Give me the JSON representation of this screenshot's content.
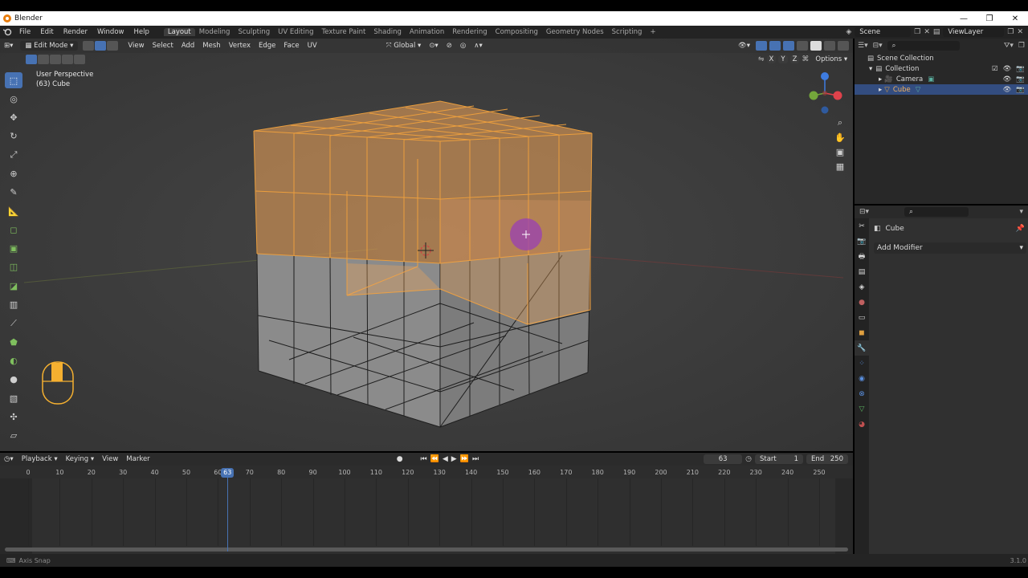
{
  "window": {
    "title": "Blender",
    "minimize_glyph": "—",
    "maximize_glyph": "❐",
    "close_glyph": "✕"
  },
  "menu": {
    "items": [
      "File",
      "Edit",
      "Render",
      "Window",
      "Help"
    ],
    "workspaces": [
      "Layout",
      "Modeling",
      "Sculpting",
      "UV Editing",
      "Texture Paint",
      "Shading",
      "Animation",
      "Rendering",
      "Compositing",
      "Geometry Nodes",
      "Scripting"
    ],
    "active_workspace": "Layout",
    "add_workspace": "+",
    "scene": "Scene",
    "view_layer": "ViewLayer"
  },
  "viewport_header": {
    "mode": "Edit Mode",
    "menus": [
      "View",
      "Select",
      "Add",
      "Mesh",
      "Vertex",
      "Edge",
      "Face",
      "UV"
    ],
    "transform_orientation": "Global",
    "axes": [
      "X",
      "Y",
      "Z"
    ],
    "options": "Options"
  },
  "viewport": {
    "perspective": "User Perspective",
    "object_info": "(63) Cube",
    "gizmo": {
      "x_color": "#e0424b",
      "y_color": "#74a63b",
      "z_color": "#3e7ce0"
    }
  },
  "toolbar": {
    "tools": [
      "select-box-icon",
      "cursor-icon",
      "move-icon",
      "rotate-icon",
      "scale-icon",
      "transform-icon",
      "annotate-icon",
      "measure-icon",
      "add-cube-icon",
      "extrude-icon",
      "inset-icon",
      "bevel-icon",
      "loop-cut-icon",
      "knife-icon",
      "poly-build-icon",
      "spin-icon",
      "smooth-icon",
      "edge-slide-icon",
      "shrink-icon",
      "shear-icon",
      "rip-icon"
    ],
    "active_tool": "select-box-icon"
  },
  "outliner": {
    "root": "Scene Collection",
    "collection": "Collection",
    "items": [
      {
        "name": "Camera",
        "selected": false
      },
      {
        "name": "Cube",
        "selected": true
      }
    ]
  },
  "properties": {
    "object_name": "Cube",
    "add_modifier": "Add Modifier"
  },
  "timeline": {
    "menus": [
      "Playback",
      "Keying",
      "View",
      "Marker"
    ],
    "current_frame": "63",
    "start_label": "Start",
    "start": "1",
    "end_label": "End",
    "end": "250",
    "ticks": [
      "0",
      "10",
      "20",
      "30",
      "40",
      "50",
      "60",
      "70",
      "80",
      "90",
      "100",
      "110",
      "120",
      "130",
      "140",
      "150",
      "160",
      "170",
      "180",
      "190",
      "200",
      "210",
      "220",
      "230",
      "240",
      "250"
    ]
  },
  "status": {
    "left": "Axis Snap",
    "version": "3.1.0"
  },
  "colors": {
    "accent": "#4772b3",
    "selection": "#f2a65a",
    "active_object": "#334d80"
  }
}
